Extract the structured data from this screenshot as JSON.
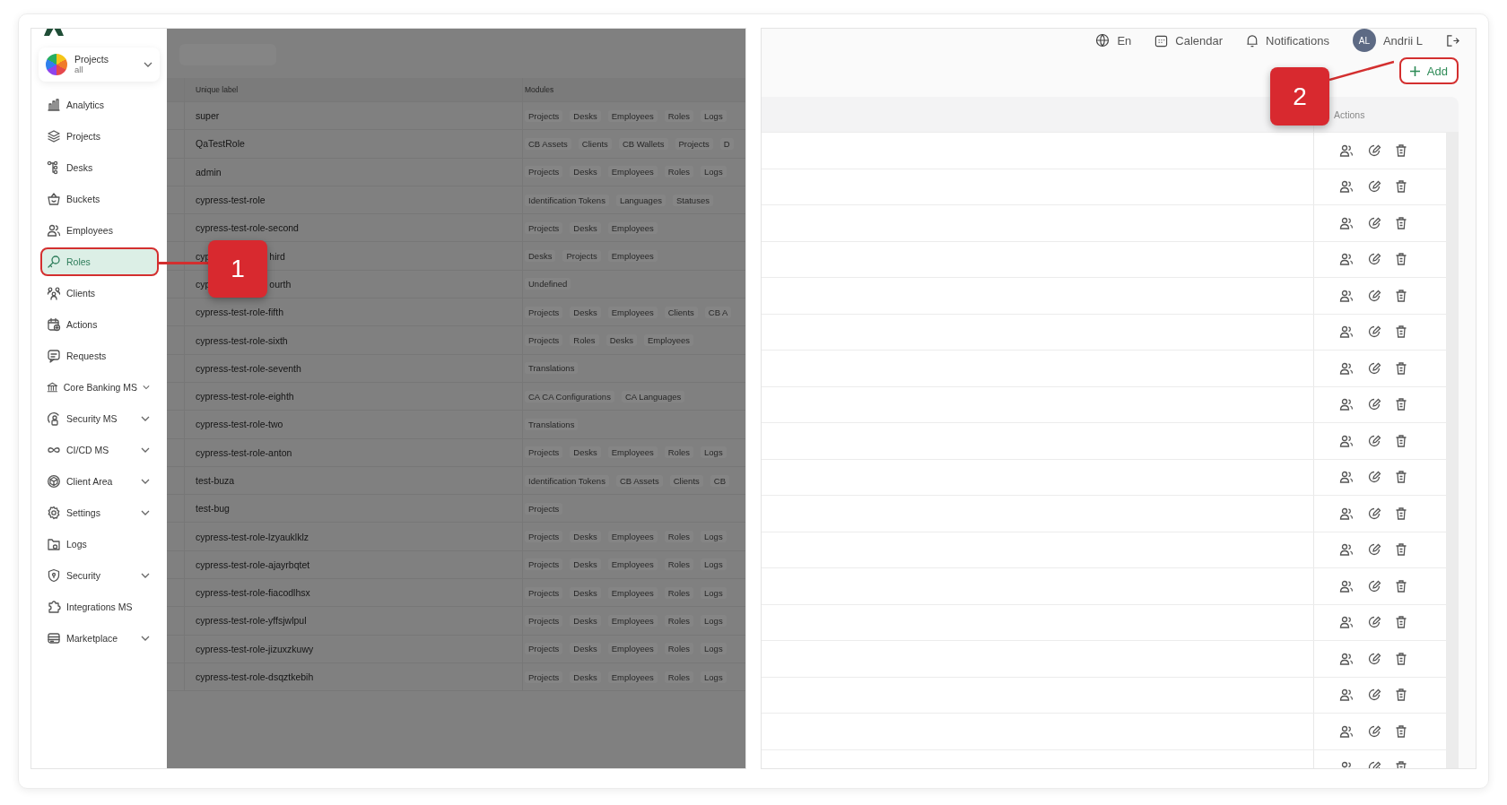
{
  "sidebar": {
    "project_selector": {
      "title": "Projects",
      "subtitle": "all"
    },
    "items": [
      {
        "label": "Analytics",
        "selected": false,
        "expandable": false
      },
      {
        "label": "Projects",
        "selected": false,
        "expandable": false
      },
      {
        "label": "Desks",
        "selected": false,
        "expandable": false
      },
      {
        "label": "Buckets",
        "selected": false,
        "expandable": false
      },
      {
        "label": "Employees",
        "selected": false,
        "expandable": false
      },
      {
        "label": "Roles",
        "selected": true,
        "expandable": false
      },
      {
        "label": "Clients",
        "selected": false,
        "expandable": false
      },
      {
        "label": "Actions",
        "selected": false,
        "expandable": false
      },
      {
        "label": "Requests",
        "selected": false,
        "expandable": false
      },
      {
        "label": "Core Banking MS",
        "selected": false,
        "expandable": true
      },
      {
        "label": "Security MS",
        "selected": false,
        "expandable": true
      },
      {
        "label": "CI/CD MS",
        "selected": false,
        "expandable": true
      },
      {
        "label": "Client Area",
        "selected": false,
        "expandable": true
      },
      {
        "label": "Settings",
        "selected": false,
        "expandable": true
      },
      {
        "label": "Logs",
        "selected": false,
        "expandable": false
      },
      {
        "label": "Security",
        "selected": false,
        "expandable": true
      },
      {
        "label": "Integrations MS",
        "selected": false,
        "expandable": false
      },
      {
        "label": "Marketplace",
        "selected": false,
        "expandable": true
      }
    ]
  },
  "roles_table": {
    "columns": [
      "Unique label",
      "Modules"
    ],
    "rows": [
      {
        "label": "super",
        "modules": [
          "Projects",
          "Desks",
          "Employees",
          "Roles",
          "Logs"
        ]
      },
      {
        "label": "QaTestRole",
        "modules": [
          "CB Assets",
          "Clients",
          "CB Wallets",
          "Projects",
          "D"
        ]
      },
      {
        "label": "admin",
        "modules": [
          "Projects",
          "Desks",
          "Employees",
          "Roles",
          "Logs"
        ]
      },
      {
        "label": "cypress-test-role",
        "modules": [
          "Identification Tokens",
          "Languages",
          "Statuses"
        ]
      },
      {
        "label": "cypress-test-role-second",
        "modules": [
          "Projects",
          "Desks",
          "Employees"
        ]
      },
      {
        "label": "cyp",
        "label_after": "hird",
        "modules": [
          "Desks",
          "Projects",
          "Employees"
        ]
      },
      {
        "label": "cyp",
        "label_after": "ourth",
        "modules": [
          "Undefined"
        ]
      },
      {
        "label": "cypress-test-role-fifth",
        "modules": [
          "Projects",
          "Desks",
          "Employees",
          "Clients",
          "CB A"
        ]
      },
      {
        "label": "cypress-test-role-sixth",
        "modules": [
          "Projects",
          "Roles",
          "Desks",
          "Employees"
        ]
      },
      {
        "label": "cypress-test-role-seventh",
        "modules": [
          "Translations"
        ]
      },
      {
        "label": "cypress-test-role-eighth",
        "modules": [
          "CA CA Configurations",
          "CA Languages"
        ]
      },
      {
        "label": "cypress-test-role-two",
        "modules": [
          "Translations"
        ]
      },
      {
        "label": "cypress-test-role-anton",
        "modules": [
          "Projects",
          "Desks",
          "Employees",
          "Roles",
          "Logs"
        ]
      },
      {
        "label": "test-buza",
        "modules": [
          "Identification Tokens",
          "CB Assets",
          "Clients",
          "CB"
        ]
      },
      {
        "label": "test-bug",
        "modules": [
          "Projects"
        ]
      },
      {
        "label": "cypress-test-role-lzyauklklz",
        "modules": [
          "Projects",
          "Desks",
          "Employees",
          "Roles",
          "Logs"
        ]
      },
      {
        "label": "cypress-test-role-ajayrbqtet",
        "modules": [
          "Projects",
          "Desks",
          "Employees",
          "Roles",
          "Logs"
        ]
      },
      {
        "label": "cypress-test-role-fiacodlhsx",
        "modules": [
          "Projects",
          "Desks",
          "Employees",
          "Roles",
          "Logs"
        ]
      },
      {
        "label": "cypress-test-role-yffsjwlpul",
        "modules": [
          "Projects",
          "Desks",
          "Employees",
          "Roles",
          "Logs"
        ]
      },
      {
        "label": "cypress-test-role-jizuxzkuwy",
        "modules": [
          "Projects",
          "Desks",
          "Employees",
          "Roles",
          "Logs"
        ]
      },
      {
        "label": "cypress-test-role-dsqztkebih",
        "modules": [
          "Projects",
          "Desks",
          "Employees",
          "Roles",
          "Logs"
        ]
      }
    ]
  },
  "header": {
    "language": "En",
    "calendar": "Calendar",
    "notifications": "Notifications",
    "user_initials": "AL",
    "user_name": "Andrii L"
  },
  "add_button": "Add",
  "actions_table": {
    "columns": [
      "Actions"
    ],
    "rows": [
      {
        "kind": "actions"
      },
      {
        "kind": "actions"
      },
      {
        "kind": "actions"
      },
      {
        "kind": "actions"
      },
      {
        "kind": "actions"
      },
      {
        "kind": "actions"
      },
      {
        "kind": "actions"
      },
      {
        "kind": "actions"
      },
      {
        "kind": "actions"
      },
      {
        "kind": "actions"
      },
      {
        "kind": "actions"
      },
      {
        "kind": "actions"
      },
      {
        "kind": "actions"
      },
      {
        "kind": "actions"
      },
      {
        "kind": "actions"
      },
      {
        "kind": "actions"
      },
      {
        "kind": "actions"
      },
      {
        "kind": "actions"
      }
    ]
  },
  "callouts": [
    {
      "number": "1"
    },
    {
      "number": "2"
    }
  ]
}
